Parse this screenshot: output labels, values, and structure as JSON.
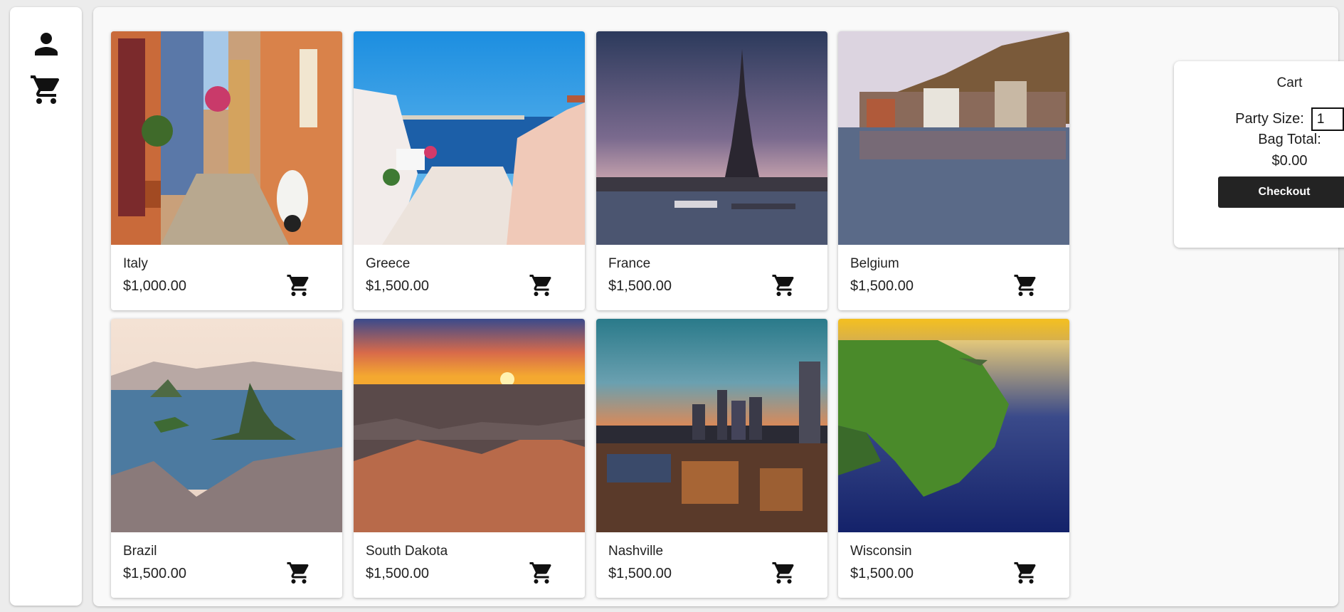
{
  "sidebar": {
    "icons": [
      "person-icon",
      "shopping-cart-icon"
    ]
  },
  "products": [
    {
      "name": "Italy",
      "price": "$1,000.00"
    },
    {
      "name": "Greece",
      "price": "$1,500.00"
    },
    {
      "name": "France",
      "price": "$1,500.00"
    },
    {
      "name": "Belgium",
      "price": "$1,500.00"
    },
    {
      "name": "Brazil",
      "price": "$1,500.00"
    },
    {
      "name": "South Dakota",
      "price": "$1,500.00"
    },
    {
      "name": "Nashville",
      "price": "$1,500.00"
    },
    {
      "name": "Wisconsin",
      "price": "$1,500.00"
    }
  ],
  "cart": {
    "title": "Cart",
    "party_size_label": "Party Size:",
    "party_size_value": "1",
    "bag_total_label": "Bag Total:",
    "bag_total_value": "$0.00",
    "checkout_label": "Checkout"
  },
  "colors": {
    "icon": "#111111",
    "checkout_bg": "#232323",
    "panel_bg": "#ffffff",
    "page_bg": "#f9f9f9"
  }
}
